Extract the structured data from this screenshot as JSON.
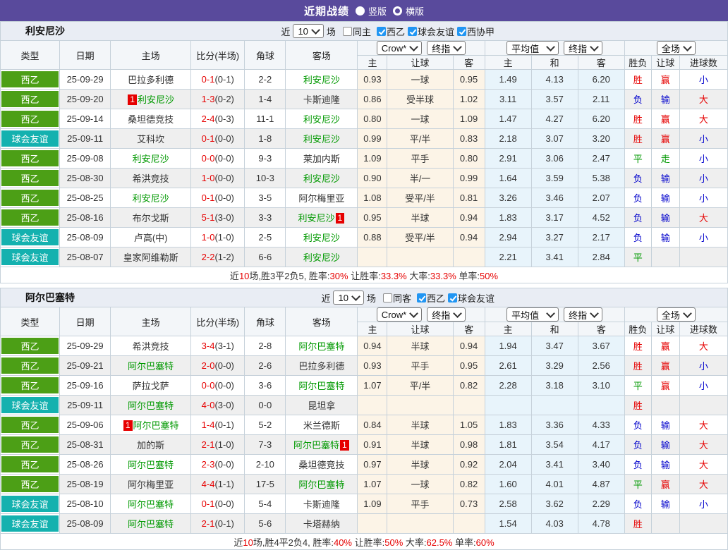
{
  "topbar": {
    "title": "近期战绩",
    "radio_vertical": "竖版",
    "radio_horizontal": "横版"
  },
  "colors": {
    "purple": "#594a9c",
    "badge_league": "#4c9f16",
    "badge_friendly": "#14b1af",
    "red": "#e60000",
    "blue": "#0000cc",
    "green": "#009900",
    "cream": "#fcf4e7",
    "light_blue": "#e8f4fb",
    "alt_row": "#efefef"
  },
  "filter_labels": {
    "near": "近",
    "count": "10",
    "games": "场"
  },
  "table_header": {
    "cols": [
      "类型",
      "日期",
      "主场",
      "比分(半场)",
      "角球",
      "客场"
    ],
    "sub": [
      "主",
      "让球",
      "客",
      "主",
      "和",
      "客",
      "胜负",
      "让球",
      "进球数"
    ],
    "selects": [
      "Crow*",
      "终指",
      "平均值",
      "终指",
      "全场"
    ]
  },
  "sections": [
    {
      "team": "利安尼沙",
      "filters": [
        {
          "label": "同主",
          "checked": false
        },
        {
          "label": "西乙",
          "checked": true
        },
        {
          "label": "球会友谊",
          "checked": true
        },
        {
          "label": "西协甲",
          "checked": true
        }
      ],
      "rows": [
        {
          "type": "西乙",
          "tc": "l",
          "date": "25-09-29",
          "home": "巴拉多利德",
          "hg": 0,
          "hb": "",
          "score": "0-1",
          "half": "(0-1)",
          "corner": "2-2",
          "away": "利安尼沙",
          "ag": 1,
          "ab": "",
          "o": [
            "0.93",
            "一球",
            "0.95"
          ],
          "a": [
            "1.49",
            "4.13",
            "6.20"
          ],
          "r": [
            [
              "胜",
              "rd"
            ],
            [
              "赢",
              "rd"
            ],
            [
              "小",
              "bl"
            ]
          ]
        },
        {
          "type": "西乙",
          "tc": "l",
          "date": "25-09-20",
          "home": "利安尼沙",
          "hg": 1,
          "hb": "1",
          "score": "1-3",
          "half": "(0-2)",
          "corner": "1-4",
          "away": "卡斯迪隆",
          "ag": 0,
          "ab": "",
          "o": [
            "0.86",
            "受半球",
            "1.02"
          ],
          "a": [
            "3.11",
            "3.57",
            "2.11"
          ],
          "r": [
            [
              "负",
              "bl"
            ],
            [
              "输",
              "bl"
            ],
            [
              "大",
              "rd"
            ]
          ]
        },
        {
          "type": "西乙",
          "tc": "l",
          "date": "25-09-14",
          "home": "桑坦德竞技",
          "hg": 0,
          "hb": "",
          "score": "2-4",
          "half": "(0-3)",
          "corner": "11-1",
          "away": "利安尼沙",
          "ag": 1,
          "ab": "",
          "o": [
            "0.80",
            "一球",
            "1.09"
          ],
          "a": [
            "1.47",
            "4.27",
            "6.20"
          ],
          "r": [
            [
              "胜",
              "rd"
            ],
            [
              "赢",
              "rd"
            ],
            [
              "大",
              "rd"
            ]
          ]
        },
        {
          "type": "球会友谊",
          "tc": "f",
          "date": "25-09-11",
          "home": "艾科坎",
          "hg": 0,
          "hb": "",
          "score": "0-1",
          "half": "(0-0)",
          "corner": "1-8",
          "away": "利安尼沙",
          "ag": 1,
          "ab": "",
          "o": [
            "0.99",
            "平/半",
            "0.83"
          ],
          "a": [
            "2.18",
            "3.07",
            "3.20"
          ],
          "r": [
            [
              "胜",
              "rd"
            ],
            [
              "赢",
              "rd"
            ],
            [
              "小",
              "bl"
            ]
          ]
        },
        {
          "type": "西乙",
          "tc": "l",
          "date": "25-09-08",
          "home": "利安尼沙",
          "hg": 1,
          "hb": "",
          "score": "0-0",
          "half": "(0-0)",
          "corner": "9-3",
          "away": "莱加内斯",
          "ag": 0,
          "ab": "",
          "o": [
            "1.09",
            "平手",
            "0.80"
          ],
          "a": [
            "2.91",
            "3.06",
            "2.47"
          ],
          "r": [
            [
              "平",
              "gr"
            ],
            [
              "走",
              "gr"
            ],
            [
              "小",
              "bl"
            ]
          ]
        },
        {
          "type": "西乙",
          "tc": "l",
          "date": "25-08-30",
          "home": "希洪竞技",
          "hg": 0,
          "hb": "",
          "score": "1-0",
          "half": "(0-0)",
          "corner": "10-3",
          "away": "利安尼沙",
          "ag": 1,
          "ab": "",
          "o": [
            "0.90",
            "半/一",
            "0.99"
          ],
          "a": [
            "1.64",
            "3.59",
            "5.38"
          ],
          "r": [
            [
              "负",
              "bl"
            ],
            [
              "输",
              "bl"
            ],
            [
              "小",
              "bl"
            ]
          ]
        },
        {
          "type": "西乙",
          "tc": "l",
          "date": "25-08-25",
          "home": "利安尼沙",
          "hg": 1,
          "hb": "",
          "score": "0-1",
          "half": "(0-0)",
          "corner": "3-5",
          "away": "阿尔梅里亚",
          "ag": 0,
          "ab": "",
          "o": [
            "1.08",
            "受平/半",
            "0.81"
          ],
          "a": [
            "3.26",
            "3.46",
            "2.07"
          ],
          "r": [
            [
              "负",
              "bl"
            ],
            [
              "输",
              "bl"
            ],
            [
              "小",
              "bl"
            ]
          ]
        },
        {
          "type": "西乙",
          "tc": "l",
          "date": "25-08-16",
          "home": "布尔戈斯",
          "hg": 0,
          "hb": "",
          "score": "5-1",
          "half": "(3-0)",
          "corner": "3-3",
          "away": "利安尼沙",
          "ag": 1,
          "ab": "1",
          "o": [
            "0.95",
            "半球",
            "0.94"
          ],
          "a": [
            "1.83",
            "3.17",
            "4.52"
          ],
          "r": [
            [
              "负",
              "bl"
            ],
            [
              "输",
              "bl"
            ],
            [
              "大",
              "rd"
            ]
          ]
        },
        {
          "type": "球会友谊",
          "tc": "f",
          "date": "25-08-09",
          "home": "卢高(中)",
          "hg": 0,
          "hb": "",
          "score": "1-0",
          "half": "(1-0)",
          "corner": "2-5",
          "away": "利安尼沙",
          "ag": 1,
          "ab": "",
          "o": [
            "0.88",
            "受平/半",
            "0.94"
          ],
          "a": [
            "2.94",
            "3.27",
            "2.17"
          ],
          "r": [
            [
              "负",
              "bl"
            ],
            [
              "输",
              "bl"
            ],
            [
              "小",
              "bl"
            ]
          ]
        },
        {
          "type": "球会友谊",
          "tc": "f",
          "date": "25-08-07",
          "home": "皇家阿维勒斯",
          "hg": 0,
          "hb": "",
          "score": "2-2",
          "half": "(1-2)",
          "corner": "6-6",
          "away": "利安尼沙",
          "ag": 1,
          "ab": "",
          "o": [
            "",
            "",
            ""
          ],
          "a": [
            "2.21",
            "3.41",
            "2.84"
          ],
          "r": [
            [
              "平",
              "gr"
            ],
            [
              "",
              ""
            ],
            [
              "",
              ""
            ]
          ]
        }
      ],
      "summary": [
        [
          "近",
          "k"
        ],
        [
          "10",
          "r"
        ],
        [
          "场,胜3平2负5, 胜率:",
          "k"
        ],
        [
          "30%",
          "r"
        ],
        [
          " 让胜率:",
          "k"
        ],
        [
          "33.3%",
          "r"
        ],
        [
          " 大率:",
          "k"
        ],
        [
          "33.3%",
          "r"
        ],
        [
          " 单率:",
          "k"
        ],
        [
          "50%",
          "r"
        ]
      ]
    },
    {
      "team": "阿尔巴塞特",
      "filters": [
        {
          "label": "同客",
          "checked": false
        },
        {
          "label": "西乙",
          "checked": true
        },
        {
          "label": "球会友谊",
          "checked": true
        }
      ],
      "rows": [
        {
          "type": "西乙",
          "tc": "l",
          "date": "25-09-29",
          "home": "希洪竞技",
          "hg": 0,
          "hb": "",
          "score": "3-4",
          "half": "(3-1)",
          "corner": "2-8",
          "away": "阿尔巴塞特",
          "ag": 1,
          "ab": "",
          "o": [
            "0.94",
            "半球",
            "0.94"
          ],
          "a": [
            "1.94",
            "3.47",
            "3.67"
          ],
          "r": [
            [
              "胜",
              "rd"
            ],
            [
              "赢",
              "rd"
            ],
            [
              "大",
              "rd"
            ]
          ]
        },
        {
          "type": "西乙",
          "tc": "l",
          "date": "25-09-21",
          "home": "阿尔巴塞特",
          "hg": 1,
          "hb": "",
          "score": "2-0",
          "half": "(0-0)",
          "corner": "2-6",
          "away": "巴拉多利德",
          "ag": 0,
          "ab": "",
          "o": [
            "0.93",
            "平手",
            "0.95"
          ],
          "a": [
            "2.61",
            "3.29",
            "2.56"
          ],
          "r": [
            [
              "胜",
              "rd"
            ],
            [
              "赢",
              "rd"
            ],
            [
              "小",
              "bl"
            ]
          ]
        },
        {
          "type": "西乙",
          "tc": "l",
          "date": "25-09-16",
          "home": "萨拉戈萨",
          "hg": 0,
          "hb": "",
          "score": "0-0",
          "half": "(0-0)",
          "corner": "3-6",
          "away": "阿尔巴塞特",
          "ag": 1,
          "ab": "",
          "o": [
            "1.07",
            "平/半",
            "0.82"
          ],
          "a": [
            "2.28",
            "3.18",
            "3.10"
          ],
          "r": [
            [
              "平",
              "gr"
            ],
            [
              "赢",
              "rd"
            ],
            [
              "小",
              "bl"
            ]
          ]
        },
        {
          "type": "球会友谊",
          "tc": "f",
          "date": "25-09-11",
          "home": "阿尔巴塞特",
          "hg": 1,
          "hb": "",
          "score": "4-0",
          "half": "(3-0)",
          "corner": "0-0",
          "away": "昆坦拿",
          "ag": 0,
          "ab": "",
          "o": [
            "",
            "",
            ""
          ],
          "a": [
            "",
            "",
            ""
          ],
          "r": [
            [
              "胜",
              "rd"
            ],
            [
              "",
              ""
            ],
            [
              "",
              ""
            ]
          ]
        },
        {
          "type": "西乙",
          "tc": "l",
          "date": "25-09-06",
          "home": "阿尔巴塞特",
          "hg": 1,
          "hb": "1",
          "score": "1-4",
          "half": "(0-1)",
          "corner": "5-2",
          "away": "米兰德斯",
          "ag": 0,
          "ab": "",
          "o": [
            "0.84",
            "半球",
            "1.05"
          ],
          "a": [
            "1.83",
            "3.36",
            "4.33"
          ],
          "r": [
            [
              "负",
              "bl"
            ],
            [
              "输",
              "bl"
            ],
            [
              "大",
              "rd"
            ]
          ]
        },
        {
          "type": "西乙",
          "tc": "l",
          "date": "25-08-31",
          "home": "加的斯",
          "hg": 0,
          "hb": "",
          "score": "2-1",
          "half": "(1-0)",
          "corner": "7-3",
          "away": "阿尔巴塞特",
          "ag": 1,
          "ab": "1",
          "o": [
            "0.91",
            "半球",
            "0.98"
          ],
          "a": [
            "1.81",
            "3.54",
            "4.17"
          ],
          "r": [
            [
              "负",
              "bl"
            ],
            [
              "输",
              "bl"
            ],
            [
              "大",
              "rd"
            ]
          ]
        },
        {
          "type": "西乙",
          "tc": "l",
          "date": "25-08-26",
          "home": "阿尔巴塞特",
          "hg": 1,
          "hb": "",
          "score": "2-3",
          "half": "(0-0)",
          "corner": "2-10",
          "away": "桑坦德竞技",
          "ag": 0,
          "ab": "",
          "o": [
            "0.97",
            "半球",
            "0.92"
          ],
          "a": [
            "2.04",
            "3.41",
            "3.40"
          ],
          "r": [
            [
              "负",
              "bl"
            ],
            [
              "输",
              "bl"
            ],
            [
              "大",
              "rd"
            ]
          ]
        },
        {
          "type": "西乙",
          "tc": "l",
          "date": "25-08-19",
          "home": "阿尔梅里亚",
          "hg": 0,
          "hb": "",
          "score": "4-4",
          "half": "(1-1)",
          "corner": "17-5",
          "away": "阿尔巴塞特",
          "ag": 1,
          "ab": "",
          "o": [
            "1.07",
            "一球",
            "0.82"
          ],
          "a": [
            "1.60",
            "4.01",
            "4.87"
          ],
          "r": [
            [
              "平",
              "gr"
            ],
            [
              "赢",
              "rd"
            ],
            [
              "大",
              "rd"
            ]
          ]
        },
        {
          "type": "球会友谊",
          "tc": "f",
          "date": "25-08-10",
          "home": "阿尔巴塞特",
          "hg": 1,
          "hb": "",
          "score": "0-1",
          "half": "(0-0)",
          "corner": "5-4",
          "away": "卡斯迪隆",
          "ag": 0,
          "ab": "",
          "o": [
            "1.09",
            "平手",
            "0.73"
          ],
          "a": [
            "2.58",
            "3.62",
            "2.29"
          ],
          "r": [
            [
              "负",
              "bl"
            ],
            [
              "输",
              "bl"
            ],
            [
              "小",
              "bl"
            ]
          ]
        },
        {
          "type": "球会友谊",
          "tc": "f",
          "date": "25-08-09",
          "home": "阿尔巴塞特",
          "hg": 1,
          "hb": "",
          "score": "2-1",
          "half": "(0-1)",
          "corner": "5-6",
          "away": "卡塔赫纳",
          "ag": 0,
          "ab": "",
          "o": [
            "",
            "",
            ""
          ],
          "a": [
            "1.54",
            "4.03",
            "4.78"
          ],
          "r": [
            [
              "胜",
              "rd"
            ],
            [
              "",
              ""
            ],
            [
              "",
              ""
            ]
          ]
        }
      ],
      "summary": [
        [
          "近",
          "k"
        ],
        [
          "10",
          "r"
        ],
        [
          "场,胜4平2负4, 胜率:",
          "k"
        ],
        [
          "40%",
          "r"
        ],
        [
          " 让胜率:",
          "k"
        ],
        [
          "50%",
          "r"
        ],
        [
          " 大率:",
          "k"
        ],
        [
          "62.5%",
          "r"
        ],
        [
          " 单率:",
          "k"
        ],
        [
          "60%",
          "r"
        ]
      ]
    }
  ]
}
